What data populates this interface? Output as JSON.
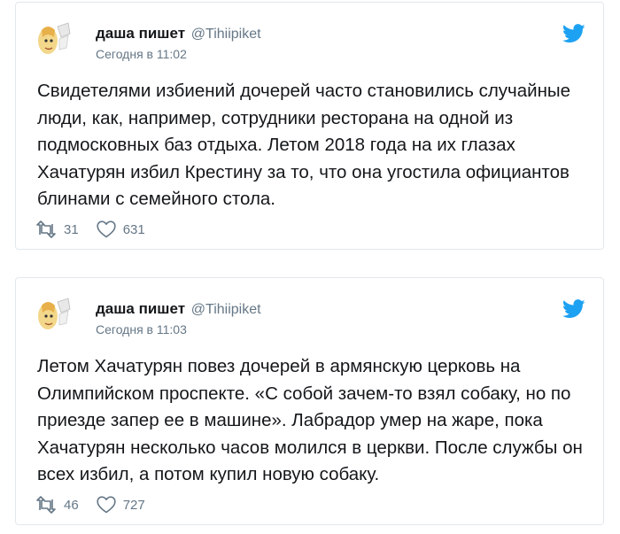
{
  "tweets": [
    {
      "author_name": "даша пишет",
      "author_handle": "@Tihiipiket",
      "timestamp": "Сегодня в 11:02",
      "text": "Свидетелями избиений дочерей часто становились случайные люди, как, например, сотрудники ресторана на одной из подмосковных баз отдыха. Летом 2018 года на их глазах Хачатурян избил Крестину за то, что она угостила официантов блинами с семейного стола.",
      "retweets": "31",
      "likes": "631"
    },
    {
      "author_name": "даша пишет",
      "author_handle": "@Tihiipiket",
      "timestamp": "Сегодня в 11:03",
      "text": "Летом Хачатурян повез дочерей в армянскую церковь на Олимпийском проспекте. «С собой зачем-то взял собаку, но по приезде запер ее в машине». Лабрадор умер на жаре, пока Хачатурян несколько часов молился в церкви. После службы он всех избил, а потом купил новую собаку.",
      "retweets": "46",
      "likes": "727"
    }
  ],
  "icons": {
    "brand": "twitter-bird-icon",
    "retweet": "retweet-icon",
    "like": "heart-icon"
  },
  "colors": {
    "twitter_blue": "#1da1f2",
    "text": "#14171a",
    "secondary": "#657786",
    "border": "#e1e8ed"
  }
}
